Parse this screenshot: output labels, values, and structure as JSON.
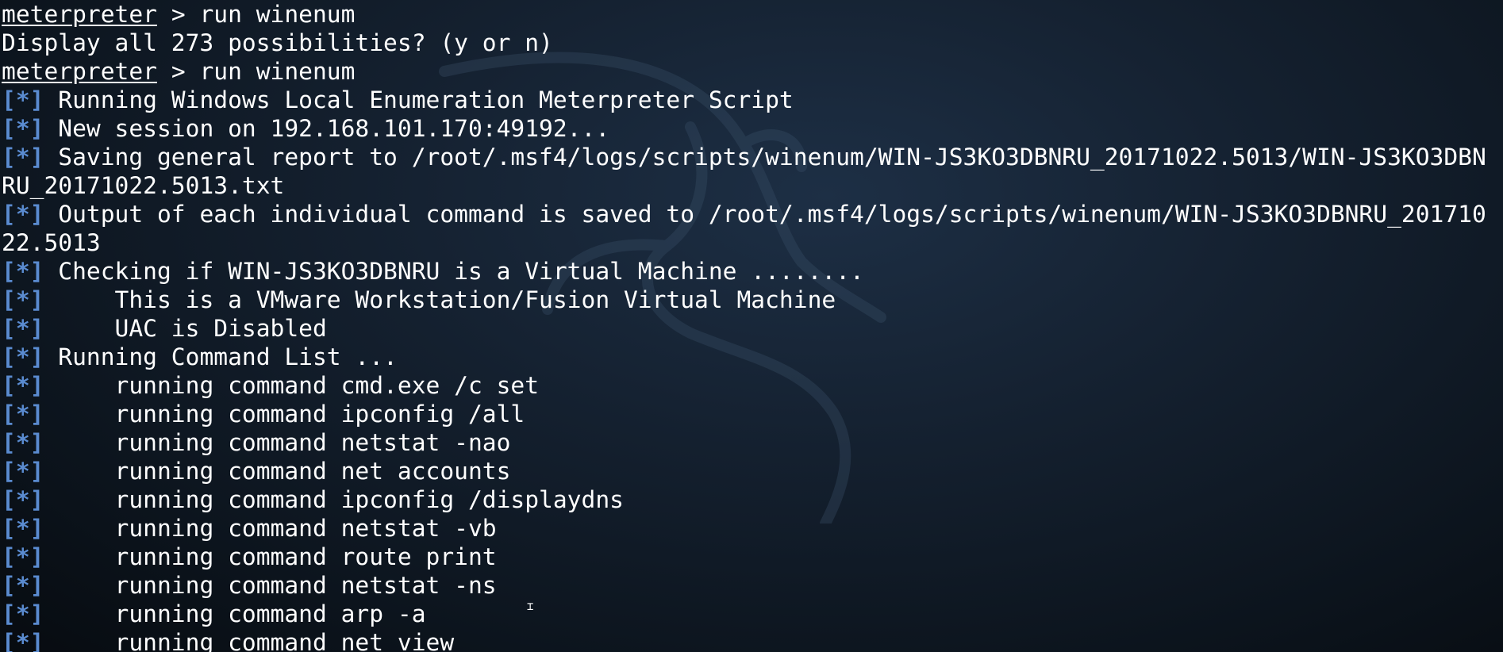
{
  "terminal": {
    "prompt": "meterpreter",
    "tag": "[*]",
    "lines": [
      {
        "type": "prompt",
        "text": " > run winenum"
      },
      {
        "type": "plain",
        "text": "Display all 273 possibilities? (y or n)"
      },
      {
        "type": "prompt",
        "text": " > run winenum"
      },
      {
        "type": "info",
        "text": " Running Windows Local Enumeration Meterpreter Script"
      },
      {
        "type": "info",
        "text": " New session on 192.168.101.170:49192..."
      },
      {
        "type": "info",
        "text": " Saving general report to /root/.msf4/logs/scripts/winenum/WIN-JS3KO3DBNRU_20171022.5013/WIN-JS3KO3DBN"
      },
      {
        "type": "plain",
        "text": "RU_20171022.5013.txt"
      },
      {
        "type": "info",
        "text": " Output of each individual command is saved to /root/.msf4/logs/scripts/winenum/WIN-JS3KO3DBNRU_201710"
      },
      {
        "type": "plain",
        "text": "22.5013"
      },
      {
        "type": "info",
        "text": " Checking if WIN-JS3KO3DBNRU is a Virtual Machine ........"
      },
      {
        "type": "info",
        "text": "     This is a VMware Workstation/Fusion Virtual Machine"
      },
      {
        "type": "info",
        "text": "     UAC is Disabled"
      },
      {
        "type": "info",
        "text": " Running Command List ..."
      },
      {
        "type": "info",
        "text": "     running command cmd.exe /c set"
      },
      {
        "type": "info",
        "text": "     running command ipconfig /all"
      },
      {
        "type": "info",
        "text": "     running command netstat -nao"
      },
      {
        "type": "info",
        "text": "     running command net accounts"
      },
      {
        "type": "info",
        "text": "     running command ipconfig /displaydns"
      },
      {
        "type": "info",
        "text": "     running command netstat -vb"
      },
      {
        "type": "info",
        "text": "     running command route print"
      },
      {
        "type": "info",
        "text": "     running command netstat -ns"
      },
      {
        "type": "info",
        "text": "     running command arp -a"
      },
      {
        "type": "info",
        "text": "     running command net view"
      }
    ]
  },
  "colors": {
    "background": "#111b27",
    "text": "#ffffff",
    "tag": "#5a8bd0"
  },
  "cursor_icon": "text-cursor-icon",
  "watermark_icon": "kali-dragon-icon"
}
